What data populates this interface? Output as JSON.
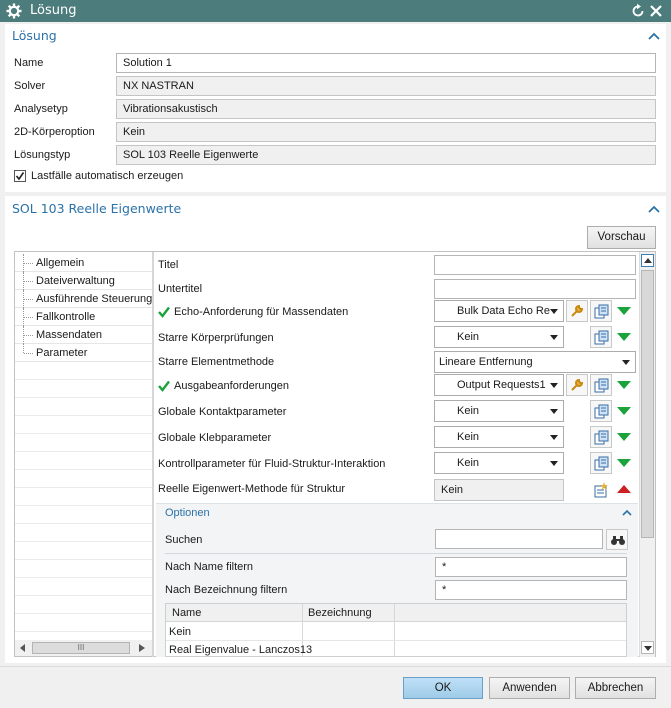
{
  "window": {
    "title": "Lösung"
  },
  "solution_section": {
    "title": "Lösung",
    "fields": [
      {
        "label": "Name",
        "value": "Solution 1"
      },
      {
        "label": "Solver",
        "value": "NX NASTRAN"
      },
      {
        "label": "Analysetyp",
        "value": "Vibrationsakustisch"
      },
      {
        "label": "2D-Körperoption",
        "value": "Kein"
      },
      {
        "label": "Lösungstyp",
        "value": "SOL 103 Reelle Eigenwerte"
      }
    ],
    "checkbox": {
      "label": "Lastfälle automatisch erzeugen",
      "checked": true
    }
  },
  "sol_section": {
    "title": "SOL 103 Reelle Eigenwerte",
    "preview_button": "Vorschau",
    "nav": [
      "Allgemein",
      "Dateiverwaltung",
      "Ausführende Steuerung",
      "Fallkontrolle",
      "Massendaten",
      "Parameter"
    ],
    "nav_selected": "Parameter",
    "props": {
      "titel": {
        "label": "Titel",
        "value": ""
      },
      "untertitel": {
        "label": "Untertitel",
        "value": ""
      },
      "echo": {
        "label": "Echo-Anforderung für Massendaten",
        "value": "Bulk Data Echo Re"
      },
      "starre_kp": {
        "label": "Starre Körperprüfungen",
        "value": "Kein"
      },
      "starre_em": {
        "label": "Starre Elementmethode",
        "value": "Lineare Entfernung"
      },
      "ausgabe": {
        "label": "Ausgabeanforderungen",
        "value": "Output Requests1"
      },
      "kontakt": {
        "label": "Globale Kontaktparameter",
        "value": "Kein"
      },
      "kleb": {
        "label": "Globale Klebparameter",
        "value": "Kein"
      },
      "fsi": {
        "label": "Kontrollparameter für Fluid-Struktur-Interaktion",
        "value": "Kein"
      },
      "eigen": {
        "label": "Reelle Eigenwert-Methode für Struktur",
        "value": "Kein"
      }
    },
    "options": {
      "title": "Optionen",
      "suchen_label": "Suchen",
      "suchen_value": "",
      "name_filter_label": "Nach Name filtern",
      "name_filter_value": "*",
      "bez_filter_label": "Nach Bezeichnung filtern",
      "bez_filter_value": "*",
      "table": {
        "headers": [
          "Name",
          "Bezeichnung"
        ],
        "rows": [
          [
            "Kein",
            ""
          ],
          [
            "Real Eigenvalue - Lanczos1",
            "3"
          ]
        ]
      }
    },
    "hscroll_grip": "III"
  },
  "footer": {
    "ok": "OK",
    "apply": "Anwenden",
    "cancel": "Abbrechen"
  },
  "colors": {
    "titlebar": "#4c7c7c",
    "section_title": "#2a72a8",
    "ok_button": "#a8d2ef",
    "valid_check": "#1aa33a"
  }
}
